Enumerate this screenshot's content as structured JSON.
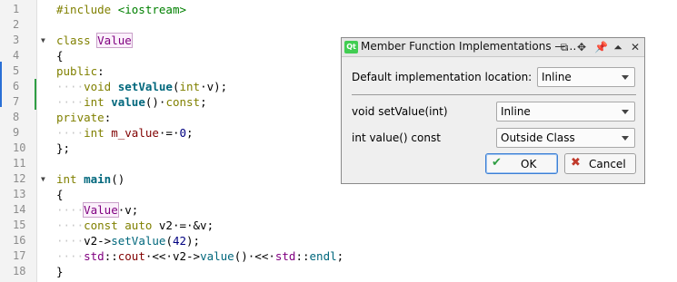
{
  "editor": {
    "lines": [
      {
        "n": "1",
        "fold": "",
        "tokens": [
          {
            "t": "#include ",
            "c": "kw"
          },
          {
            "t": "<iostream>",
            "c": "str"
          }
        ]
      },
      {
        "n": "2",
        "fold": "",
        "tokens": []
      },
      {
        "n": "3",
        "fold": "▼",
        "tokens": [
          {
            "t": "class ",
            "c": "kw"
          },
          {
            "t": "Value",
            "c": "cls hl"
          }
        ]
      },
      {
        "n": "4",
        "fold": "",
        "tokens": [
          {
            "t": "{",
            "c": ""
          }
        ]
      },
      {
        "n": "5",
        "fold": "",
        "tokens": [
          {
            "t": "public",
            "c": "kw"
          },
          {
            "t": ":",
            "c": ""
          }
        ]
      },
      {
        "n": "6",
        "fold": "",
        "mark": true,
        "tokens": [
          {
            "t": "····",
            "c": "ws"
          },
          {
            "t": "void ",
            "c": "ty"
          },
          {
            "t": "setValue",
            "c": "fn"
          },
          {
            "t": "(",
            "c": ""
          },
          {
            "t": "int",
            "c": "ty"
          },
          {
            "t": "·v);",
            "c": ""
          }
        ]
      },
      {
        "n": "7",
        "fold": "",
        "mark": true,
        "tokens": [
          {
            "t": "····",
            "c": "ws"
          },
          {
            "t": "int ",
            "c": "ty"
          },
          {
            "t": "value",
            "c": "fn"
          },
          {
            "t": "()·",
            "c": ""
          },
          {
            "t": "const",
            "c": "kw"
          },
          {
            "t": ";",
            "c": ""
          }
        ]
      },
      {
        "n": "8",
        "fold": "",
        "tokens": [
          {
            "t": "private",
            "c": "kw"
          },
          {
            "t": ":",
            "c": ""
          }
        ]
      },
      {
        "n": "9",
        "fold": "",
        "tokens": [
          {
            "t": "····",
            "c": "ws"
          },
          {
            "t": "int ",
            "c": "ty"
          },
          {
            "t": "m_value",
            "c": "mem"
          },
          {
            "t": "·=·",
            "c": ""
          },
          {
            "t": "0",
            "c": "num"
          },
          {
            "t": ";",
            "c": ""
          }
        ]
      },
      {
        "n": "10",
        "fold": "",
        "tokens": [
          {
            "t": "};",
            "c": ""
          }
        ]
      },
      {
        "n": "11",
        "fold": "",
        "tokens": []
      },
      {
        "n": "12",
        "fold": "▼",
        "tokens": [
          {
            "t": "int ",
            "c": "ty"
          },
          {
            "t": "main",
            "c": "fn"
          },
          {
            "t": "()",
            "c": ""
          }
        ]
      },
      {
        "n": "13",
        "fold": "",
        "tokens": [
          {
            "t": "{",
            "c": ""
          }
        ]
      },
      {
        "n": "14",
        "fold": "",
        "tokens": [
          {
            "t": "····",
            "c": "ws"
          },
          {
            "t": "Value",
            "c": "cls hl"
          },
          {
            "t": "·v;",
            "c": ""
          }
        ]
      },
      {
        "n": "15",
        "fold": "",
        "tokens": [
          {
            "t": "····",
            "c": "ws"
          },
          {
            "t": "const ",
            "c": "kw"
          },
          {
            "t": "auto ",
            "c": "ty"
          },
          {
            "t": "v2·=·&v;",
            "c": ""
          }
        ]
      },
      {
        "n": "16",
        "fold": "",
        "tokens": [
          {
            "t": "····",
            "c": "ws"
          },
          {
            "t": "v2->",
            "c": ""
          },
          {
            "t": "setValue",
            "c": "fncall"
          },
          {
            "t": "(",
            "c": ""
          },
          {
            "t": "42",
            "c": "num"
          },
          {
            "t": ");",
            "c": ""
          }
        ]
      },
      {
        "n": "17",
        "fold": "",
        "tokens": [
          {
            "t": "····",
            "c": "ws"
          },
          {
            "t": "std",
            "c": "cls"
          },
          {
            "t": "::",
            "c": ""
          },
          {
            "t": "cout",
            "c": "mem"
          },
          {
            "t": "·<<·v2->",
            "c": ""
          },
          {
            "t": "value",
            "c": "fncall"
          },
          {
            "t": "()·<<·",
            "c": ""
          },
          {
            "t": "std",
            "c": "cls"
          },
          {
            "t": "::",
            "c": ""
          },
          {
            "t": "endl",
            "c": "fncall"
          },
          {
            "t": ";",
            "c": ""
          }
        ]
      },
      {
        "n": "18",
        "fold": "",
        "tokens": [
          {
            "t": "}",
            "c": ""
          }
        ]
      }
    ]
  },
  "dialog": {
    "title": "Member Function Implementations —…",
    "icon": "Qt",
    "titlebar_icons": [
      "float-icon",
      "move-icon",
      "pin-icon",
      "maximize-icon",
      "close-icon"
    ],
    "default_label": "Default implementation location:",
    "default_value": "Inline",
    "rows": [
      {
        "label": "void setValue(int)",
        "value": "Inline"
      },
      {
        "label": "int value() const",
        "value": "Outside Class"
      }
    ],
    "ok_label": "OK",
    "cancel_label": "Cancel"
  }
}
